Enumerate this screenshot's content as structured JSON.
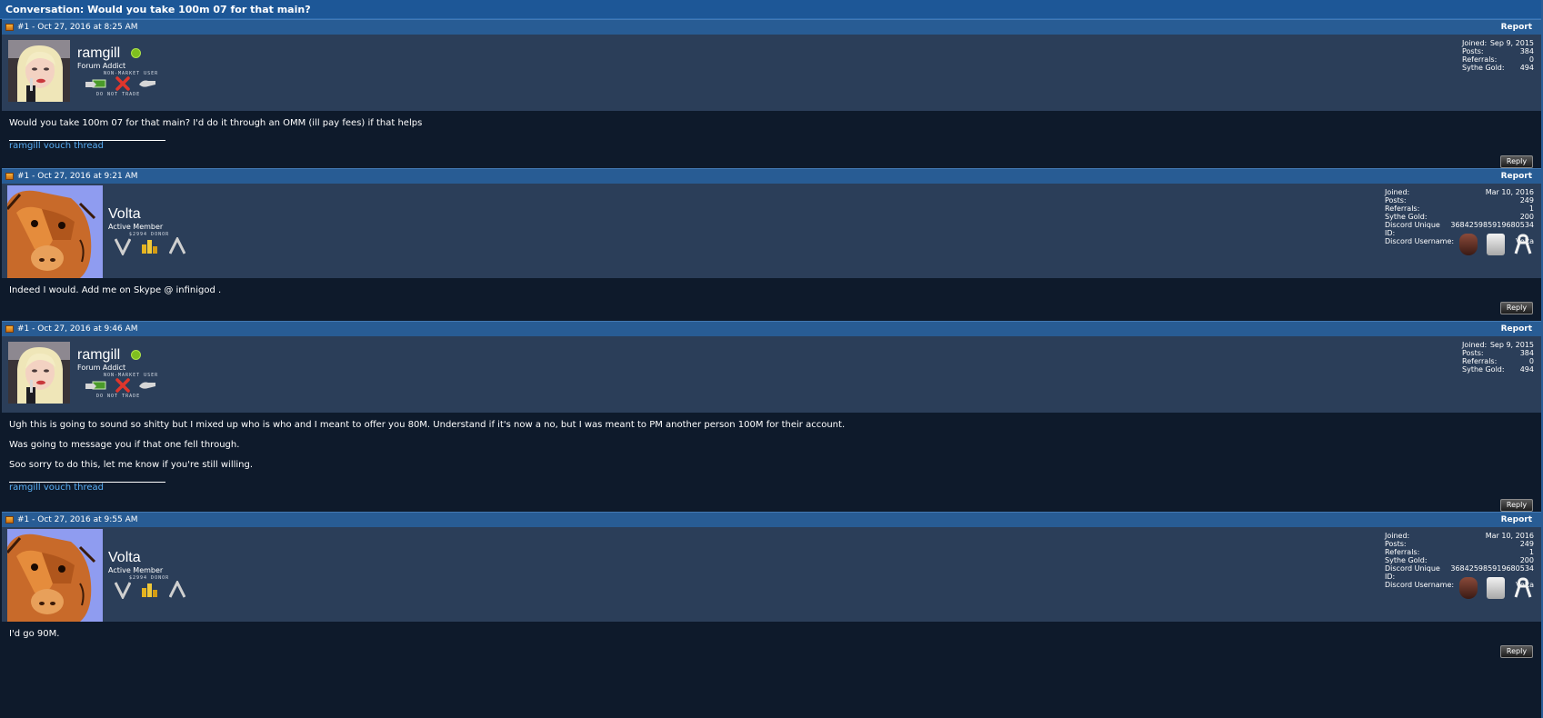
{
  "conversation": {
    "title": "Conversation: Would you take 100m 07 for that main?"
  },
  "posts": [
    {
      "date": "#1 - Oct 27, 2016 at 8:25 AM",
      "report": "Report",
      "username": "ramgill",
      "usertitle": "Forum Addict",
      "badge_caption_top": "NON-MARKET USER",
      "badge_caption_bottom": "DO NOT TRADE",
      "stats": {
        "joined_label": "Joined:",
        "joined": "Sep 9, 2015",
        "posts_label": "Posts:",
        "posts": "384",
        "referrals_label": "Referrals:",
        "referrals": "0",
        "gold_label": "Sythe Gold:",
        "gold": "494"
      },
      "message": [
        "Would you take 100m 07 for that main? I'd do it through an OMM (ill pay fees) if that helps"
      ],
      "signature": "ramgill vouch thread",
      "reply": "Reply"
    },
    {
      "date": "#1 - Oct 27, 2016 at 9:21 AM",
      "report": "Report",
      "username": "Volta",
      "usertitle": "Active Member",
      "badge_caption_top": "$2994 DONOR",
      "stats": {
        "joined_label": "Joined:",
        "joined": "Mar 10, 2016",
        "posts_label": "Posts:",
        "posts": "249",
        "referrals_label": "Referrals:",
        "referrals": "1",
        "gold_label": "Sythe Gold:",
        "gold": "200",
        "discord_id_label": "Discord Unique ID:",
        "discord_id": "368425985919680534",
        "discord_user_label": "Discord Username:",
        "discord_user": "Volta"
      },
      "message": [
        "Indeed I would. Add me on Skype @ infinigod ."
      ],
      "reply": "Reply"
    },
    {
      "date": "#1 - Oct 27, 2016 at 9:46 AM",
      "report": "Report",
      "username": "ramgill",
      "usertitle": "Forum Addict",
      "badge_caption_top": "NON-MARKET USER",
      "badge_caption_bottom": "DO NOT TRADE",
      "stats": {
        "joined_label": "Joined:",
        "joined": "Sep 9, 2015",
        "posts_label": "Posts:",
        "posts": "384",
        "referrals_label": "Referrals:",
        "referrals": "0",
        "gold_label": "Sythe Gold:",
        "gold": "494"
      },
      "message": [
        "Ugh this is going to sound so shitty but I mixed up who is who and I meant to offer you 80M. Understand if it's now a no, but I was meant to PM another person 100M for their account.",
        "Was going to message you if that one fell through.",
        "Soo sorry to do this, let me know if you're still willing."
      ],
      "signature": "ramgill vouch thread",
      "reply": "Reply"
    },
    {
      "date": "#1 - Oct 27, 2016 at 9:55 AM",
      "report": "Report",
      "username": "Volta",
      "usertitle": "Active Member",
      "badge_caption_top": "$2994 DONOR",
      "stats": {
        "joined_label": "Joined:",
        "joined": "Mar 10, 2016",
        "posts_label": "Posts:",
        "posts": "249",
        "referrals_label": "Referrals:",
        "referrals": "1",
        "gold_label": "Sythe Gold:",
        "gold": "200",
        "discord_id_label": "Discord Unique ID:",
        "discord_id": "368425985919680534",
        "discord_user_label": "Discord Username:",
        "discord_user": "Volta"
      },
      "message": [
        "I'd go 90M."
      ],
      "reply": "Reply"
    }
  ],
  "colors": {
    "header_blue": "#1d5797",
    "post_head": "#285c94",
    "user_bar": "#2b3e59",
    "body_bg": "#0e1a2b",
    "link": "#59aef5",
    "online": "#7fbf1f"
  }
}
